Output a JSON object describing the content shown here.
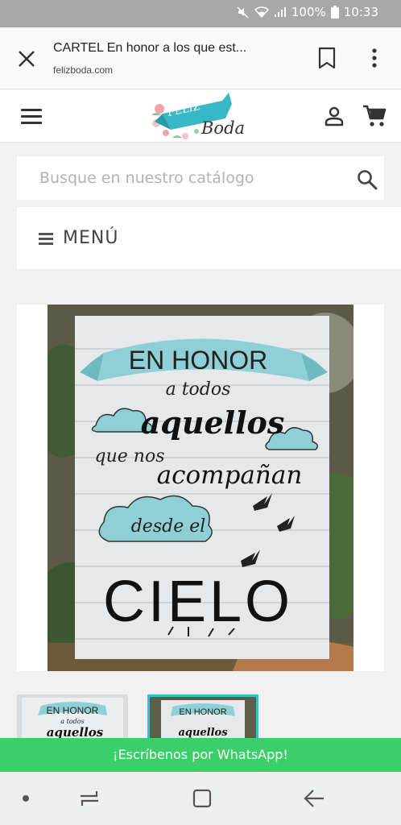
{
  "status_bar": {
    "battery_percent": "100%",
    "time": "10:33",
    "icons": [
      "mute-icon",
      "wifi-icon",
      "signal-icon",
      "battery-icon"
    ]
  },
  "browser": {
    "page_title": "CARTEL En honor a los que est...",
    "domain": "felizboda.com",
    "icons": [
      "close-icon",
      "bookmark-icon",
      "more-vert-icon"
    ]
  },
  "site": {
    "logo": {
      "ribbon_text": "FELIZ",
      "script_text": "Boda"
    },
    "icons": [
      "hamburger-icon",
      "user-icon",
      "cart-icon"
    ]
  },
  "search": {
    "placeholder": "Busque en nuestro catálogo",
    "value": ""
  },
  "menu": {
    "label": "MENÚ"
  },
  "product_sign": {
    "line1": "EN HONOR",
    "line2": "a todos",
    "line3": "aquellos",
    "line4": "que nos",
    "line5": "acompañan",
    "line6": "desde el",
    "line7": "CIELO"
  },
  "thumbnail": {
    "line1": "EN HONOR",
    "line2": "a todos",
    "line3": "aquellos"
  },
  "whatsapp": {
    "label": "¡Escríbenos por WhatsApp!"
  },
  "colors": {
    "accent_teal": "#2ec4c9",
    "cloud_blue": "#8fd0d6",
    "whatsapp_green": "#3bce6a",
    "status_bar": "#a8a8a8"
  }
}
